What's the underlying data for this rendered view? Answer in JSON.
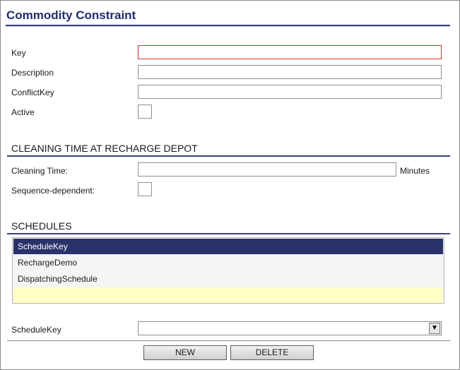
{
  "page": {
    "title": "Commodity Constraint"
  },
  "form": {
    "key_label": "Key",
    "key_value": "",
    "description_label": "Description",
    "description_value": "",
    "conflictkey_label": "ConflictKey",
    "conflictkey_value": "",
    "active_label": "Active"
  },
  "cleaning": {
    "section_title": "CLEANING TIME AT RECHARGE DEPOT",
    "cleaning_time_label": "Cleaning Time:",
    "cleaning_time_value": "",
    "unit": "Minutes",
    "sequence_label": "Sequence-dependent:"
  },
  "schedules": {
    "section_title": "SCHEDULES",
    "column_header": "ScheduleKey",
    "rows": [
      "RechargeDemo",
      "DispatchingSchedule"
    ],
    "schedulekey_label": "ScheduleKey",
    "schedulekey_selected": "",
    "dropdown_glyph": "▼"
  },
  "actions": {
    "new_label": "NEW",
    "delete_label": "DELETE"
  },
  "colors": {
    "title": "#1f2d6b",
    "rule": "#39427a",
    "list_header_bg": "#2a326b",
    "new_row_bg": "#ffffc8",
    "focus_border": "#e02a2a"
  }
}
